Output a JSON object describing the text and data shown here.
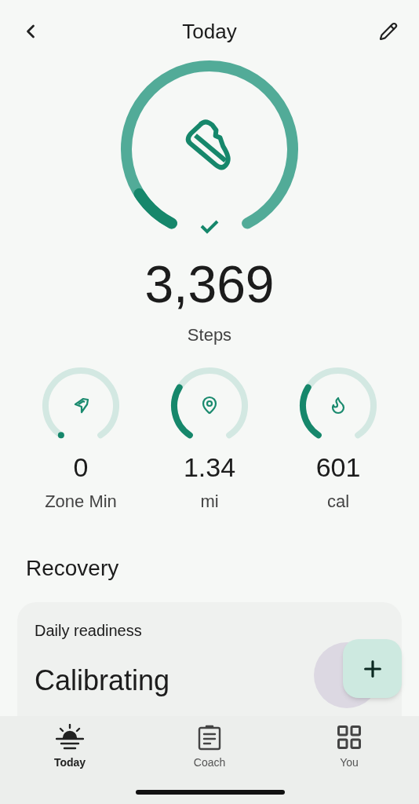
{
  "header": {
    "title": "Today"
  },
  "steps": {
    "value": "3,369",
    "label": "Steps",
    "goal_met": true
  },
  "metrics": [
    {
      "kind": "zone",
      "value": "0",
      "label": "Zone Min"
    },
    {
      "kind": "distance",
      "value": "1.34",
      "label": "mi"
    },
    {
      "kind": "calories",
      "value": "601",
      "label": "cal"
    }
  ],
  "section": {
    "title": "Recovery"
  },
  "card": {
    "title": "Daily readiness",
    "status": "Calibrating"
  },
  "nav": [
    {
      "kind": "today",
      "label": "Today",
      "selected": true
    },
    {
      "kind": "coach",
      "label": "Coach",
      "selected": false
    },
    {
      "kind": "you",
      "label": "You",
      "selected": false
    }
  ]
}
